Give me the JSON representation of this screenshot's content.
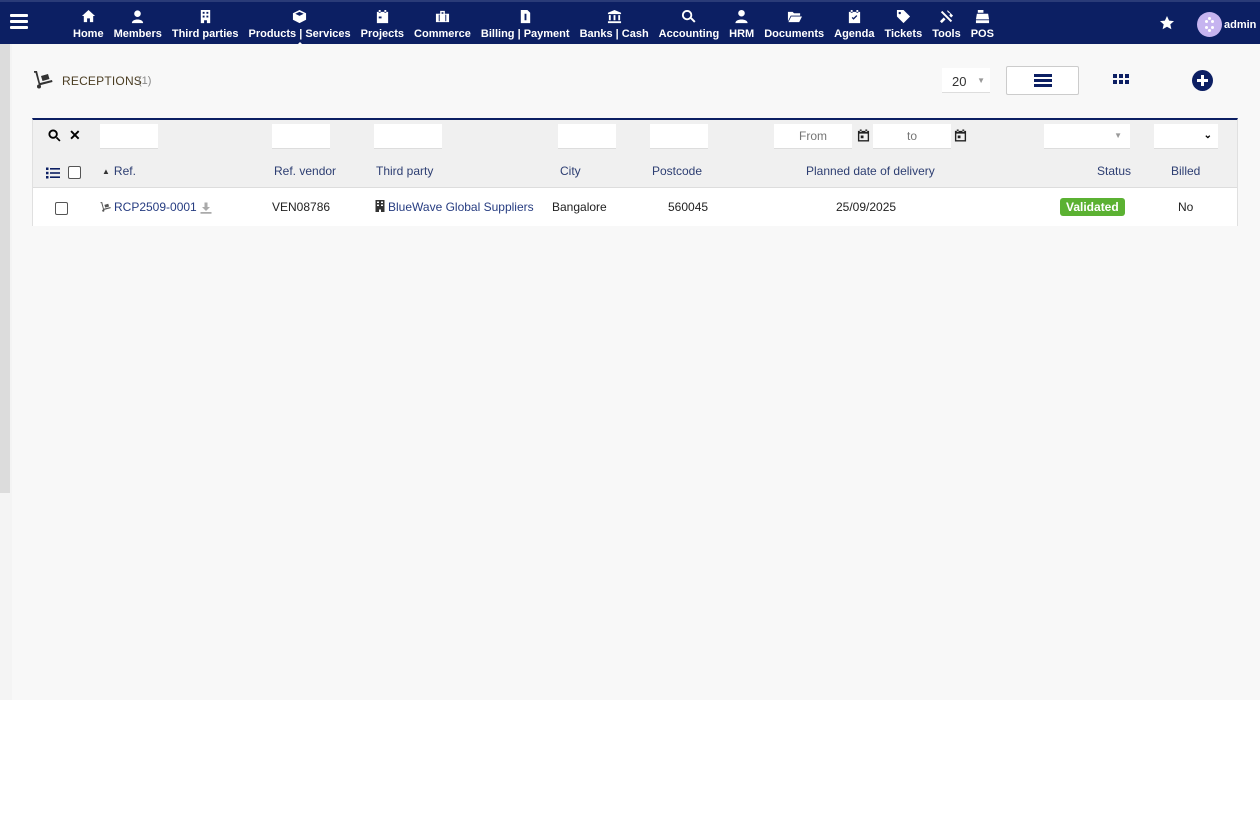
{
  "nav": {
    "items": [
      {
        "label": "Home",
        "icon": "home-icon"
      },
      {
        "label": "Members",
        "icon": "user-icon"
      },
      {
        "label": "Third parties",
        "icon": "building-icon"
      },
      {
        "label": "Products | Services",
        "icon": "cube-icon"
      },
      {
        "label": "Projects",
        "icon": "calendar-icon"
      },
      {
        "label": "Commerce",
        "icon": "briefcase-icon"
      },
      {
        "label": "Billing | Payment",
        "icon": "invoice-icon"
      },
      {
        "label": "Banks | Cash",
        "icon": "bank-icon"
      },
      {
        "label": "Accounting",
        "icon": "search-dollar-icon"
      },
      {
        "label": "HRM",
        "icon": "user-tie-icon"
      },
      {
        "label": "Documents",
        "icon": "folder-icon"
      },
      {
        "label": "Agenda",
        "icon": "calendar-check-icon"
      },
      {
        "label": "Tickets",
        "icon": "ticket-icon"
      },
      {
        "label": "Tools",
        "icon": "tools-icon"
      },
      {
        "label": "POS",
        "icon": "cash-register-icon"
      }
    ],
    "active": "Products | Services",
    "user": "admin"
  },
  "header": {
    "title": "RECEPTIONS",
    "count": "(1)",
    "limit": "20"
  },
  "filters": {
    "date_from_placeholder": "From",
    "date_to_placeholder": "to"
  },
  "columns": {
    "ref": "Ref.",
    "ref_vendor": "Ref. vendor",
    "third_party": "Third party",
    "city": "City",
    "postcode": "Postcode",
    "planned_date": "Planned date of delivery",
    "status": "Status",
    "billed": "Billed"
  },
  "rows": [
    {
      "ref": "RCP2509-0001",
      "ref_vendor": "VEN08786",
      "third_party": "BlueWave Global Suppliers",
      "city": "Bangalore",
      "postcode": "560045",
      "planned_date": "25/09/2025",
      "status": "Validated",
      "billed": "No"
    }
  ],
  "colors": {
    "navbar": "#0c1f63",
    "link": "#263c81",
    "status_validated": "#5bb132"
  }
}
